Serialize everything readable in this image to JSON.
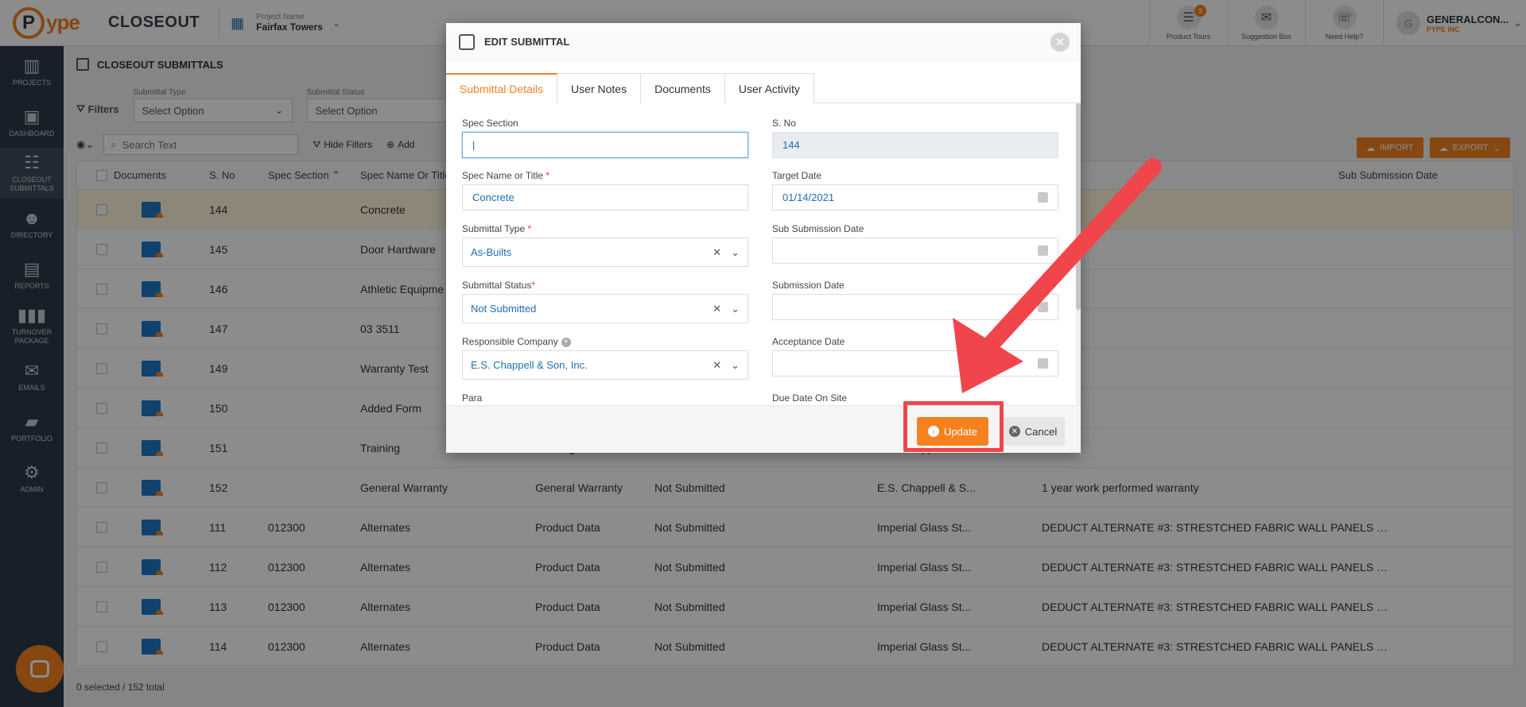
{
  "app": {
    "logo_text": "ype",
    "logo_letter": "P",
    "title": "CLOSEOUT",
    "project_label": "Project Name",
    "project_name": "Fairfax Towers"
  },
  "top_right": {
    "items": [
      {
        "label": "Product Tours",
        "badge": "9",
        "icon": "tours-icon"
      },
      {
        "label": "Suggestion Box",
        "icon": "suggestion-icon"
      },
      {
        "label": "Need Help?",
        "icon": "help-icon"
      }
    ],
    "user_initial": "G",
    "user_name": "GENERALCON...",
    "user_org": "PYPE INC"
  },
  "sidebar": {
    "items": [
      {
        "label": "PROJECTS",
        "icon": "building-icon"
      },
      {
        "label": "DASHBOARD",
        "icon": "dashboard-icon"
      },
      {
        "label": "CLOSEOUT SUBMITTALS",
        "icon": "submittals-icon",
        "active": true
      },
      {
        "label": "DIRECTORY",
        "icon": "people-icon"
      },
      {
        "label": "REPORTS",
        "icon": "reports-icon"
      },
      {
        "label": "TURNOVER PACKAGE",
        "icon": "package-icon"
      },
      {
        "label": "EMAILS",
        "icon": "email-icon"
      },
      {
        "label": "PORTFOLIO",
        "icon": "briefcase-icon"
      },
      {
        "label": "ADMIN",
        "icon": "gear-icon"
      }
    ]
  },
  "page": {
    "title": "CLOSEOUT SUBMITTALS",
    "filters_label": "Filters",
    "filter_type_label": "Submittal Type",
    "filter_type_value": "Select Option",
    "filter_status_label": "Submittal Status",
    "filter_status_value": "Select Option",
    "search_placeholder": "Search Text",
    "hide_filters": "Hide Filters",
    "add": "Add",
    "import": "IMPORT",
    "export": "EXPORT",
    "footer_count": "0 selected / 152 total"
  },
  "table": {
    "headers": {
      "documents": "Documents",
      "sno": "S. No",
      "spec_section": "Spec Section",
      "spec_name": "Spec Name Or Title",
      "description": "ion",
      "sub_submission": "Sub Submission Date"
    },
    "rows": [
      {
        "sno": "144",
        "section": "",
        "name": "Concrete",
        "type": "",
        "status": "",
        "company": "",
        "desc": ""
      },
      {
        "sno": "145",
        "section": "",
        "name": "Door Hardware",
        "type": "",
        "status": "",
        "company": "",
        "desc": ""
      },
      {
        "sno": "146",
        "section": "",
        "name": "Athletic Equipme",
        "type": "",
        "status": "",
        "company": "",
        "desc": ""
      },
      {
        "sno": "147",
        "section": "",
        "name": "03 3511",
        "type": "",
        "status": "",
        "company": "",
        "desc": ""
      },
      {
        "sno": "149",
        "section": "",
        "name": "Warranty Test",
        "type": "",
        "status": "",
        "company": "",
        "desc": ""
      },
      {
        "sno": "150",
        "section": "",
        "name": "Added Form",
        "type": "",
        "status": "",
        "company": "",
        "desc": ""
      },
      {
        "sno": "151",
        "section": "",
        "name": "Training",
        "type": "Training",
        "status": "Not Submitted",
        "company": "E.S. Chappell & S...",
        "desc": ""
      },
      {
        "sno": "152",
        "section": "",
        "name": "General Warranty",
        "type": "General Warranty",
        "status": "Not Submitted",
        "company": "E.S. Chappell & S...",
        "desc": "1 year work performed warranty"
      },
      {
        "sno": "111",
        "section": "012300",
        "name": "Alternates",
        "type": "Product Data",
        "status": "Not Submitted",
        "company": "Imperial Glass St...",
        "desc": "DEDUCT ALTERNATE #3: STRESTCHED FABRIC WALL PANELS 1. I..."
      },
      {
        "sno": "112",
        "section": "012300",
        "name": "Alternates",
        "type": "Product Data",
        "status": "Not Submitted",
        "company": "Imperial Glass St...",
        "desc": "DEDUCT ALTERNATE #3: STRESTCHED FABRIC WALL PANELS 1. I..."
      },
      {
        "sno": "113",
        "section": "012300",
        "name": "Alternates",
        "type": "Product Data",
        "status": "Not Submitted",
        "company": "Imperial Glass St...",
        "desc": "DEDUCT ALTERNATE #3: STRESTCHED FABRIC WALL PANELS 1. I..."
      },
      {
        "sno": "114",
        "section": "012300",
        "name": "Alternates",
        "type": "Product Data",
        "status": "Not Submitted",
        "company": "Imperial Glass St...",
        "desc": "DEDUCT ALTERNATE #3: STRESTCHED FABRIC WALL PANELS 1. I..."
      }
    ]
  },
  "modal": {
    "title": "EDIT SUBMITTAL",
    "tabs": [
      "Submittal Details",
      "User Notes",
      "Documents",
      "User Activity"
    ],
    "fields": {
      "spec_section_label": "Spec Section",
      "spec_section_value": "",
      "sno_label": "S. No",
      "sno_value": "144",
      "spec_name_label": "Spec Name or Title",
      "spec_name_value": "Concrete",
      "target_date_label": "Target Date",
      "target_date_value": "01/14/2021",
      "submittal_type_label": "Submittal Type",
      "submittal_type_value": "As-Builts",
      "sub_submission_label": "Sub Submission Date",
      "submittal_status_label": "Submittal Status",
      "submittal_status_value": "Not Submitted",
      "submission_date_label": "Submission Date",
      "responsible_company_label": "Responsible Company",
      "responsible_company_value": "E.S. Chappell & Son, Inc.",
      "acceptance_date_label": "Acceptance Date",
      "para_label": "Para",
      "due_date_label": "Due Date On Site"
    },
    "update_label": "Update",
    "cancel_label": "Cancel"
  },
  "colors": {
    "accent": "#f5821f",
    "sidebar": "#2b3a4a",
    "link": "#1f6fae",
    "annotation": "#f0454a"
  }
}
